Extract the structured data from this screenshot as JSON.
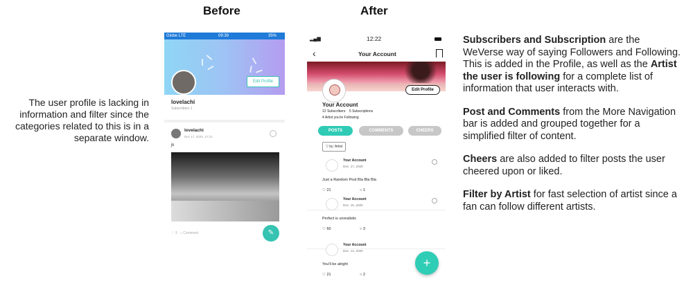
{
  "headings": {
    "before": "Before",
    "after": "After"
  },
  "left_description": "The user profile is lacking in information and filter since the categories related to this is in a separate window.",
  "before_phone": {
    "status": {
      "carrier": "Globe LTE",
      "time": "09:39",
      "battery": "35%"
    },
    "edit_profile": "Edit Profile",
    "username": "lovelachi",
    "subscribers": "Subscribers 1",
    "post": {
      "author": "lovelachi",
      "date": "Dec 17, 2020, 17:21",
      "text": "jk",
      "likes": "3",
      "comment_label": "Comment"
    },
    "fab_icon": "pencil-icon"
  },
  "after_phone": {
    "status": {
      "time": "12:22"
    },
    "title": "Your Account",
    "edit_profile": "Edit Profile",
    "account_name": "Your Account",
    "subscribers": "12 Subscribers",
    "subscriptions": "5 Subscriptions",
    "following": "4 Artist you're Following",
    "tabs": [
      {
        "label": "POSTS",
        "color": "#2fcbb5"
      },
      {
        "label": "COMMENTS",
        "color": "#c7c7c7"
      },
      {
        "label": "CHEERS",
        "color": "#c7c7c7"
      }
    ],
    "filter_label": "by: Artist",
    "posts": [
      {
        "author": "Your Account",
        "date": "Dec. 17, 2020",
        "text": "Just a Random Post Bla Bla Bla",
        "likes": "21",
        "comments": "1"
      },
      {
        "author": "Your Account",
        "date": "Dec. 15, 2020",
        "text": "Perfect is unrealistic",
        "likes": "60",
        "comments": "3"
      },
      {
        "author": "Your Account",
        "date": "Dec. 14, 2020",
        "text": "You'll be alright",
        "likes": "21",
        "comments": "2"
      }
    ],
    "fab_label": "+"
  },
  "right_notes": {
    "p1": {
      "b1": "Subscribers and Subscription",
      "t1": " are the WeVerse way of saying Followers and Following. This is added in the Profile, as well as the ",
      "b2": "Artist the user is following",
      "t2": " for a complete list of information that user interacts with."
    },
    "p2": {
      "b1": "Post and Comments",
      "t1": " from the More Navigation bar is added and grouped together for a simplified filter of content."
    },
    "p3": {
      "b1": "Cheers",
      "t1": " are also added to filter posts the user cheered upon or liked."
    },
    "p4": {
      "b1": "Filter by Artist",
      "t1": " for fast selection of artist since a fan can follow different artists."
    }
  }
}
